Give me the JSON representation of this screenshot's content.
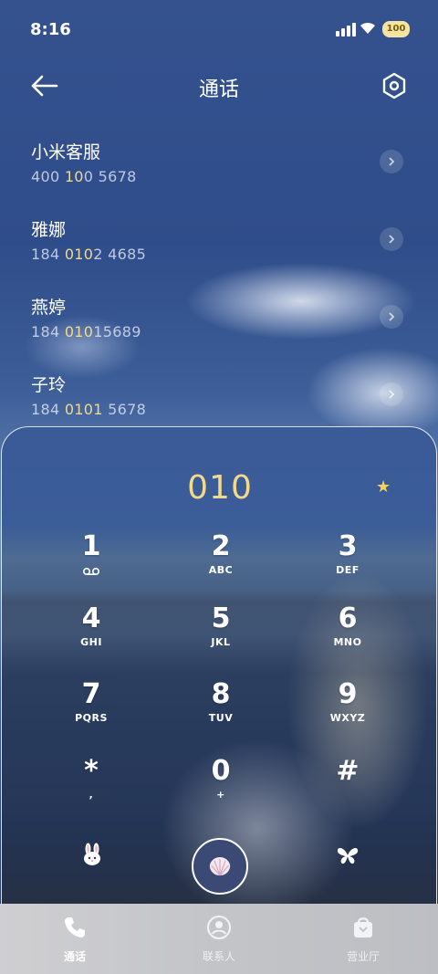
{
  "status_bar": {
    "time": "8:16",
    "battery": "100"
  },
  "header": {
    "title": "通话"
  },
  "contacts": [
    {
      "name": "小米客服",
      "number_parts": [
        "400 ",
        "10",
        "0 5678"
      ]
    },
    {
      "name": "雅娜",
      "number_parts": [
        "184 ",
        "010",
        "2 4685"
      ]
    },
    {
      "name": "燕婷",
      "number_parts": [
        "184 ",
        "010",
        "15689"
      ]
    },
    {
      "name": "子玲",
      "number_parts": [
        "184 ",
        "0101",
        " 5678"
      ]
    }
  ],
  "dialer": {
    "display": "010",
    "keys": [
      {
        "digit": "1",
        "letters": ""
      },
      {
        "digit": "2",
        "letters": "ABC"
      },
      {
        "digit": "3",
        "letters": "DEF"
      },
      {
        "digit": "4",
        "letters": "GHI"
      },
      {
        "digit": "5",
        "letters": "JKL"
      },
      {
        "digit": "6",
        "letters": "MNO"
      },
      {
        "digit": "7",
        "letters": "PQRS"
      },
      {
        "digit": "8",
        "letters": "TUV"
      },
      {
        "digit": "9",
        "letters": "WXYZ"
      },
      {
        "digit": "*",
        "letters": ","
      },
      {
        "digit": "0",
        "letters": "+"
      },
      {
        "digit": "#",
        "letters": ""
      }
    ]
  },
  "tabs": [
    {
      "label": "通话",
      "icon": "phone-icon",
      "active": true
    },
    {
      "label": "联系人",
      "icon": "person-icon",
      "active": false
    },
    {
      "label": "营业厅",
      "icon": "store-icon",
      "active": false
    }
  ],
  "colors": {
    "highlight": "#f3d98a",
    "accent": "#3a4a74"
  }
}
